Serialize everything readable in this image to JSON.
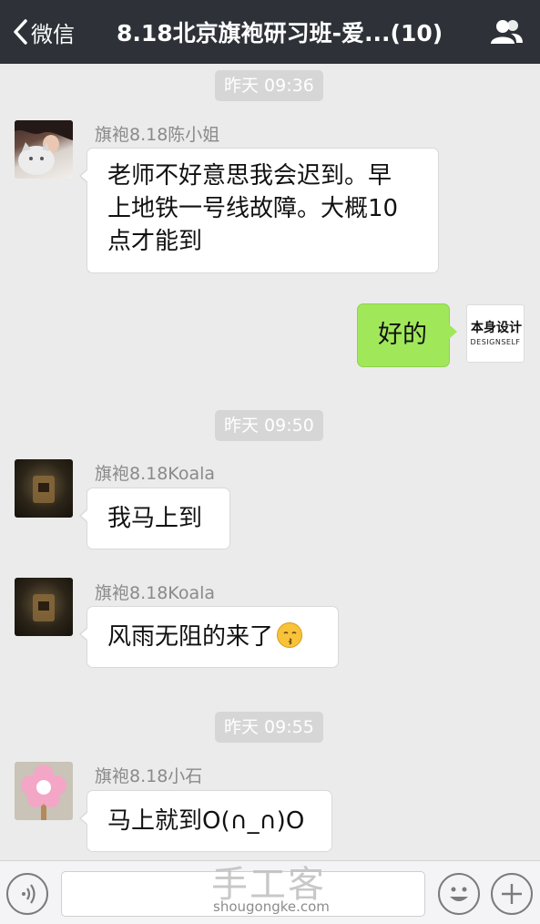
{
  "nav": {
    "back_label": "微信",
    "title": "8.18北京旗袍研习班-爱...(10)"
  },
  "timestamps": [
    "昨天 09:36",
    "昨天 09:50",
    "昨天 09:55"
  ],
  "messages": [
    {
      "sender": "旗袍8.18陈小姐",
      "text": "老师不好意思我会迟到。早",
      "text2": "上地铁一号线故障。大概10",
      "text3": "点才能到"
    },
    {
      "text": "好的",
      "avatar_text": "本身设计",
      "avatar_subtext": "DESIGNSELF"
    },
    {
      "sender": "旗袍8.18Koala",
      "text": "我马上到"
    },
    {
      "sender": "旗袍8.18Koala",
      "text": "风雨无阻的来了",
      "emoji": "kiss-emoji"
    },
    {
      "sender": "旗袍8.18小石",
      "text": "马上就到O(∩_∩)O"
    }
  ],
  "watermark": {
    "brand": "手工客",
    "domain": "shougongke.com"
  },
  "colors": {
    "navbar": "#2e3238",
    "chat_bg": "#ebebeb",
    "outgoing_bubble": "#a0e75a",
    "incoming_bubble": "#ffffff"
  },
  "icons": [
    "back-chevron-icon",
    "group-members-icon",
    "voice-icon",
    "emoji-icon",
    "plus-icon"
  ]
}
